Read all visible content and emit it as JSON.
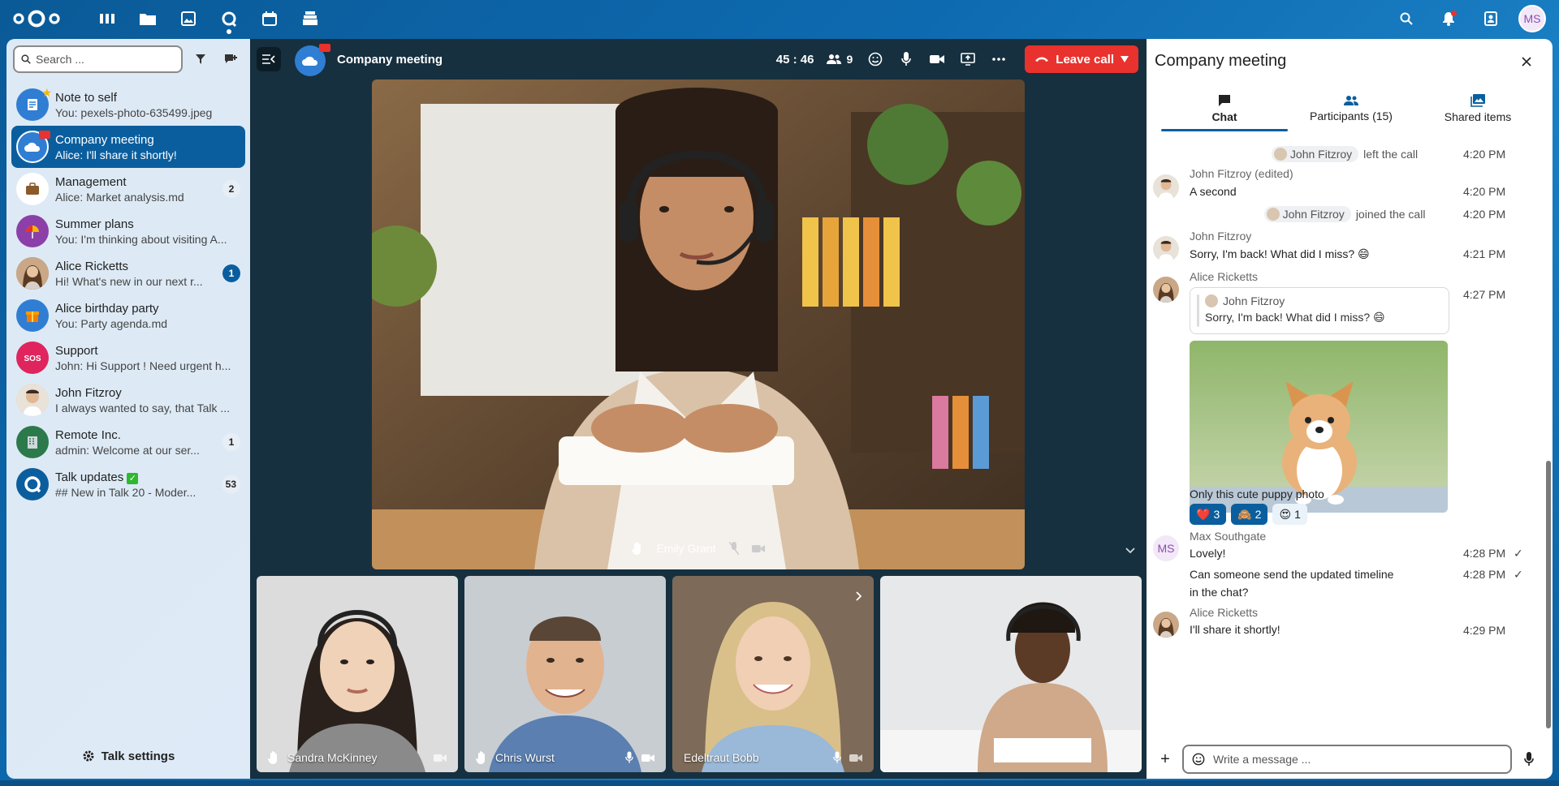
{
  "header": {
    "user_initials": "MS",
    "apps": [
      "dashboard-icon",
      "files-icon",
      "photos-icon",
      "talk-icon",
      "calendar-icon",
      "deck-icon"
    ],
    "right": [
      "search-icon",
      "bell-icon",
      "contacts-icon"
    ]
  },
  "sidebar": {
    "search_placeholder": "Search ...",
    "conversations": [
      {
        "name": "Note to self",
        "sub": "You: pexels-photo-635499.jpeg",
        "badge": "",
        "av_color": "#2f7ed3"
      },
      {
        "name": "Company meeting",
        "sub": "Alice: I'll share it shortly!",
        "badge": "",
        "av_color": "#2f7ed3"
      },
      {
        "name": "Management",
        "sub": "Alice: Market analysis.md",
        "badge": "2",
        "av_color": "#ffffff"
      },
      {
        "name": "Summer plans",
        "sub": "You: I'm thinking about visiting A...",
        "badge": "",
        "av_color": "#8c3fa8"
      },
      {
        "name": "Alice Ricketts",
        "sub": "Hi! What's new in our next r...",
        "badge": "1",
        "av_color": "#b78a6a"
      },
      {
        "name": "Alice birthday party",
        "sub": "You: Party agenda.md",
        "badge": "",
        "av_color": "#2f7ed3"
      },
      {
        "name": "Support",
        "sub": "John: Hi Support ! Need urgent h...",
        "badge": "",
        "av_color": "#e0245e"
      },
      {
        "name": "John Fitzroy",
        "sub": "I always wanted to say, that Talk ...",
        "badge": "",
        "av_color": "#d5c1a6"
      },
      {
        "name": "Remote Inc.",
        "sub": "admin: Welcome at our ser...",
        "badge": "1",
        "av_color": "#2c7a4b"
      },
      {
        "name": "Talk updates",
        "sub": "## New in Talk 20 - Moder...",
        "badge": "53",
        "av_color": "#0b5e9e"
      }
    ],
    "settings_label": "Talk settings"
  },
  "call": {
    "room_name": "Company meeting",
    "timer": "45 : 46",
    "participants_count": "9",
    "leave_label": "Leave call",
    "main_speaker": "Emily Grant",
    "tiles": [
      {
        "name": "Sandra McKinney"
      },
      {
        "name": "Chris Wurst"
      },
      {
        "name": "Edeltraut Bobb"
      },
      {
        "name": ""
      }
    ]
  },
  "panel": {
    "title": "Company meeting",
    "tabs": [
      {
        "label": "Chat"
      },
      {
        "label": "Participants (15)"
      },
      {
        "label": "Shared items"
      }
    ],
    "messages": {
      "sys1_name": "John Fitzroy",
      "sys1_text": "left the call",
      "sys1_time": "4:20 PM",
      "m1_author": "John Fitzroy (edited)",
      "m1_text": "A second",
      "m1_time": "4:20 PM",
      "sys2_name": "John Fitzroy",
      "sys2_text": "joined the call",
      "sys2_time": "4:20 PM",
      "m2_author": "John Fitzroy",
      "m2_text": "Sorry, I'm back! What did I miss? 😄",
      "m2_time": "4:21 PM",
      "m3_author": "Alice Ricketts",
      "m3_time": "4:27 PM",
      "m3_quote_author": "John Fitzroy",
      "m3_quote_text": "Sorry, I'm back! What did I miss? 😄",
      "m3_caption": "Only this cute puppy photo",
      "reactions": [
        {
          "emoji": "❤️",
          "count": "3"
        },
        {
          "emoji": "🙈",
          "count": "2"
        },
        {
          "emoji": "😍",
          "count": "1"
        }
      ],
      "m4_author": "Max Southgate",
      "m4_avatar": "MS",
      "m4_text": "Lovely!",
      "m4_time": "4:28 PM",
      "m5_text": "Can someone send the updated timeline in the chat?",
      "m5_time": "4:28 PM",
      "m6_author": "Alice Ricketts",
      "m6_text": "I'll share it shortly!",
      "m6_time": "4:29 PM"
    },
    "composer_placeholder": "Write a message ..."
  }
}
